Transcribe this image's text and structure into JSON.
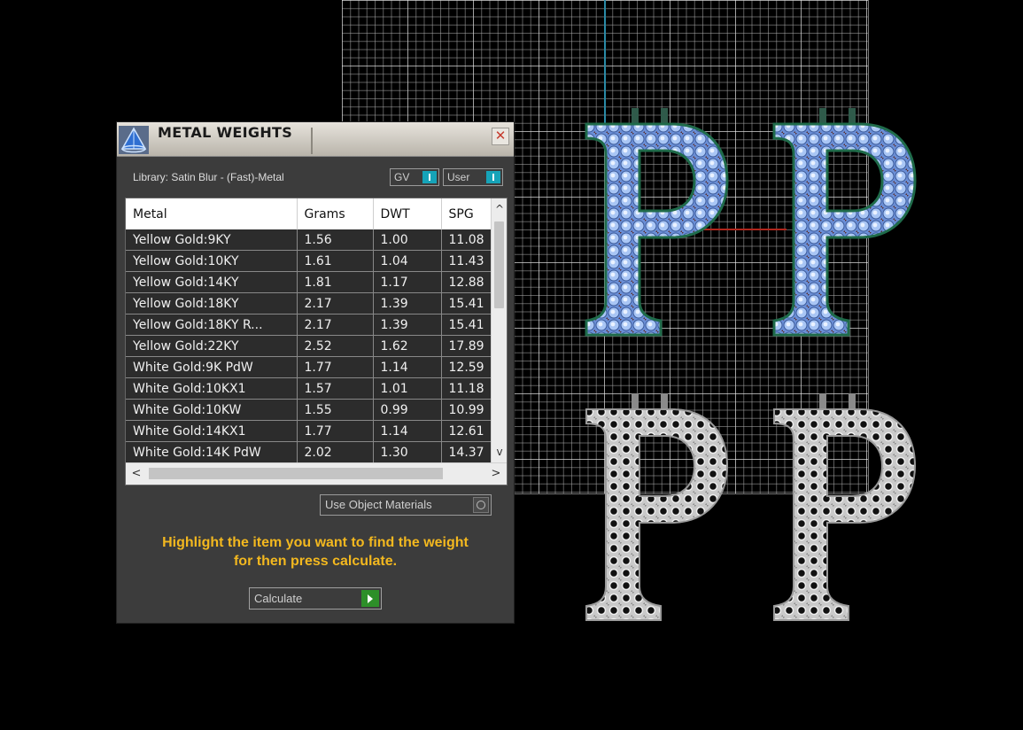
{
  "panel": {
    "title": "METAL WEIGHTS",
    "close_glyph": "✕",
    "library_label": "Library: Satin Blur - (Fast)-Metal",
    "toggle_gv": "GV",
    "toggle_user": "User",
    "use_object_materials": "Use Object Materials",
    "hint_line1": "Highlight the item you want to find the weight",
    "hint_line2": "for then press calculate.",
    "calculate": "Calculate"
  },
  "table": {
    "headers": [
      "Metal",
      "Grams",
      "DWT",
      "SPG"
    ],
    "rows": [
      {
        "metal": "Yellow Gold:9KY",
        "grams": "1.56",
        "dwt": "1.00",
        "spg": "11.08"
      },
      {
        "metal": "Yellow Gold:10KY",
        "grams": "1.61",
        "dwt": "1.04",
        "spg": "11.43"
      },
      {
        "metal": "Yellow Gold:14KY",
        "grams": "1.81",
        "dwt": "1.17",
        "spg": "12.88"
      },
      {
        "metal": "Yellow Gold:18KY",
        "grams": "2.17",
        "dwt": "1.39",
        "spg": "15.41"
      },
      {
        "metal": "Yellow Gold:18KY R...",
        "grams": "2.17",
        "dwt": "1.39",
        "spg": "15.41"
      },
      {
        "metal": "Yellow Gold:22KY",
        "grams": "2.52",
        "dwt": "1.62",
        "spg": "17.89"
      },
      {
        "metal": "White Gold:9K PdW",
        "grams": "1.77",
        "dwt": "1.14",
        "spg": "12.59"
      },
      {
        "metal": "White Gold:10KX1",
        "grams": "1.57",
        "dwt": "1.01",
        "spg": "11.18"
      },
      {
        "metal": "White Gold:10KW",
        "grams": "1.55",
        "dwt": "0.99",
        "spg": "10.99"
      },
      {
        "metal": "White Gold:14KX1",
        "grams": "1.77",
        "dwt": "1.14",
        "spg": "12.61"
      },
      {
        "metal": "White Gold:14K PdW",
        "grams": "2.02",
        "dwt": "1.30",
        "spg": "14.37"
      }
    ]
  },
  "scroll": {
    "up": "^",
    "down": "v",
    "left": "<",
    "right": ">"
  },
  "viewport": {
    "letters": [
      "P",
      "P",
      "P",
      "P"
    ],
    "colors": {
      "stone_blue": "#7fa3e6",
      "metal_silver": "#bdbdbd",
      "axis_v": "#2a8aa6",
      "axis_h": "#b0261c",
      "hint": "#f3b81f",
      "toggle_on": "#16a3b8",
      "calculate_go": "#2d8f29"
    }
  },
  "icons": {
    "app": "jewelry-cone-icon",
    "close": "close-icon",
    "play": "play-icon"
  }
}
